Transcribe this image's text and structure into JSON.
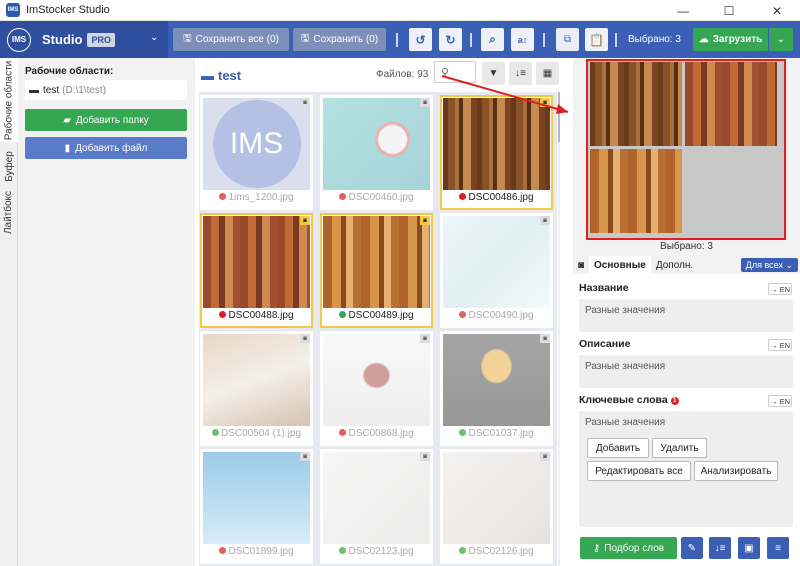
{
  "window": {
    "title": "ImStocker Studio",
    "minimize": "—",
    "maximize": "☐",
    "close": "✕"
  },
  "brand": {
    "logo": "IMS",
    "name": "Studio",
    "badge": "PRO"
  },
  "toolbar": {
    "save_all": "Сохранить все (0)",
    "save": "Сохранить (0)",
    "selected": "Выбрано: 3",
    "upload": "Загрузить"
  },
  "side_tabs": [
    "Рабочие области",
    "Буфер",
    "Лайтбокс"
  ],
  "sidebar": {
    "title": "Рабочие области:",
    "workspace_name": "test",
    "workspace_path": "(D:\\1\\test)",
    "add_folder": "Добавить папку",
    "add_file": "Добавить файл"
  },
  "gallery": {
    "folder": "test",
    "file_count": "Файлов: 93",
    "items": [
      {
        "name": "1ims_1200.jpg",
        "dot": "#e06060",
        "selected": false,
        "dim": true
      },
      {
        "name": "DSC00460.jpg",
        "dot": "#e06060",
        "selected": false,
        "dim": true
      },
      {
        "name": "DSC00486.jpg",
        "dot": "#e02020",
        "selected": true,
        "dim": false
      },
      {
        "name": "DSC00488.jpg",
        "dot": "#e02020",
        "selected": true,
        "dim": false
      },
      {
        "name": "DSC00489.jpg",
        "dot": "#35a752",
        "selected": true,
        "dim": false
      },
      {
        "name": "DSC00490.jpg",
        "dot": "#e06060",
        "selected": false,
        "dim": true
      },
      {
        "name": "DSC00504 (1).jpg",
        "dot": "#6cc070",
        "selected": false,
        "dim": true
      },
      {
        "name": "DSC00868.jpg",
        "dot": "#e06060",
        "selected": false,
        "dim": true
      },
      {
        "name": "DSC01037.jpg",
        "dot": "#6cc070",
        "selected": false,
        "dim": true
      },
      {
        "name": "DSC01899.jpg",
        "dot": "#e06060",
        "selected": false,
        "dim": true
      },
      {
        "name": "DSC02123.jpg",
        "dot": "#6cc070",
        "selected": false,
        "dim": true
      },
      {
        "name": "DSC02126.jpg",
        "dot": "#6cc070",
        "selected": false,
        "dim": true
      }
    ]
  },
  "preview": {
    "label": "Выбрано: 3"
  },
  "meta": {
    "tab_main": "Основные",
    "tab_extra": "Дополн.",
    "for_all": "Для всех",
    "title_label": "Название",
    "title_value": "Разные значения",
    "desc_label": "Описание",
    "desc_value": "Разные значения",
    "kw_label": "Ключевые слова",
    "kw_badge": "1",
    "kw_value": "Разные значения",
    "en": "→ EN",
    "add": "Добавить",
    "remove": "Удалить",
    "edit_all": "Редактировать все",
    "analyze": "Анализировать",
    "pick_words": "Подбор слов"
  },
  "colors": {
    "accent": "#3b5fb4",
    "green": "#35a752",
    "highlight": "#e02020",
    "selection": "#f5c842"
  }
}
